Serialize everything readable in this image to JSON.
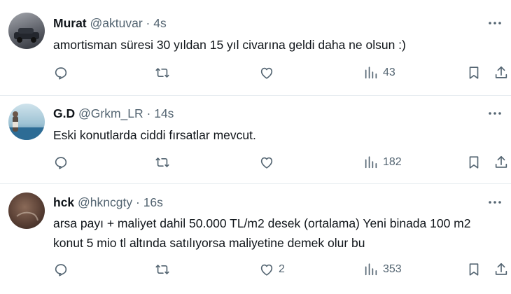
{
  "tweets": [
    {
      "name": "Murat",
      "handle": "@aktuvar",
      "separator": "·",
      "time": "4s",
      "text": "amortisman süresi 30 yıldan 15 yıl civarına geldi daha ne olsun :)",
      "likes": "",
      "views": "43",
      "avatar_colors": [
        "#7d7f86",
        "#3b3f49"
      ]
    },
    {
      "name": "G.D",
      "handle": "@Grkm_LR",
      "separator": "·",
      "time": "14s",
      "text": "Eski konutlarda ciddi fırsatlar mevcut.",
      "likes": "",
      "views": "182",
      "avatar_colors": [
        "#a9c9d6",
        "#4f7f9a"
      ]
    },
    {
      "name": "hck",
      "handle": "@hkncgty",
      "separator": "·",
      "time": "16s",
      "text": "arsa payı + maliyet dahil 50.000 TL/m2 desek (ortalama) Yeni binada 100 m2 konut 5 mio tl altında satılıyorsa maliyetine demek olur bu",
      "likes": "2",
      "views": "353",
      "avatar_colors": [
        "#7a5a4a",
        "#3a2a22"
      ]
    }
  ],
  "icons": {
    "more": "more-horizontal-icon",
    "reply": "reply-icon",
    "retweet": "retweet-icon",
    "like": "heart-icon",
    "views": "views-chart-icon",
    "bookmark": "bookmark-icon",
    "share": "share-icon"
  },
  "colors": {
    "text": "#0f1419",
    "secondary": "#536471",
    "divider": "#e6ecf0"
  }
}
